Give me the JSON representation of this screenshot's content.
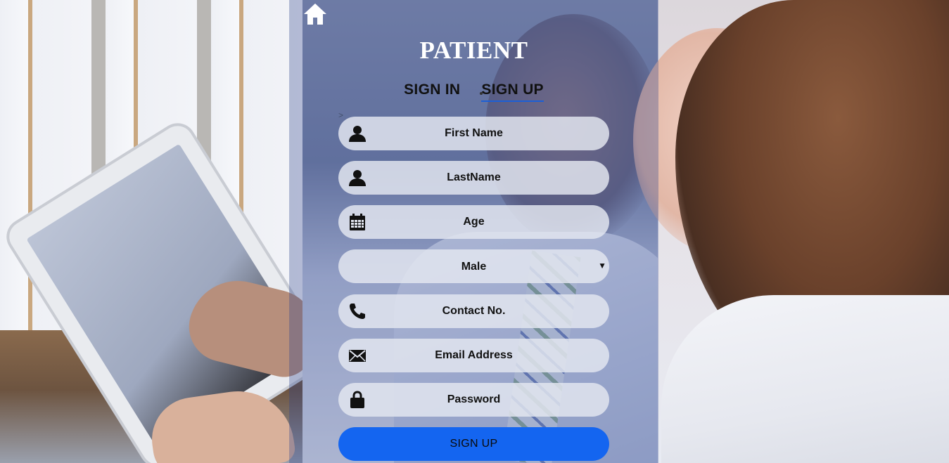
{
  "page": {
    "title": "PATIENT"
  },
  "nav": {
    "home_icon": "home-icon"
  },
  "tabs": [
    {
      "label": "SIGN IN",
      "active": false
    },
    {
      "label": "SIGN UP",
      "active": true
    }
  ],
  "form": {
    "first_name": {
      "placeholder": "First Name",
      "icon": "user-icon"
    },
    "last_name": {
      "placeholder": "LastName",
      "icon": "user-icon"
    },
    "age": {
      "placeholder": "Age",
      "icon": "calendar-icon"
    },
    "gender": {
      "selected": "Male"
    },
    "contact": {
      "placeholder": "Contact No.",
      "icon": "phone-icon"
    },
    "email": {
      "placeholder": "Email Address",
      "icon": "envelope-icon"
    },
    "password": {
      "placeholder": "Password",
      "icon": "lock-icon"
    },
    "submit_label": "SIGN UP",
    "caret_text": ">"
  },
  "colors": {
    "accent": "#1465f0",
    "tab_underline": "#1c5fd6",
    "panel_overlay": "rgba(44,64,140,0.32)",
    "field_bg": "rgba(226,230,240,0.84)"
  }
}
